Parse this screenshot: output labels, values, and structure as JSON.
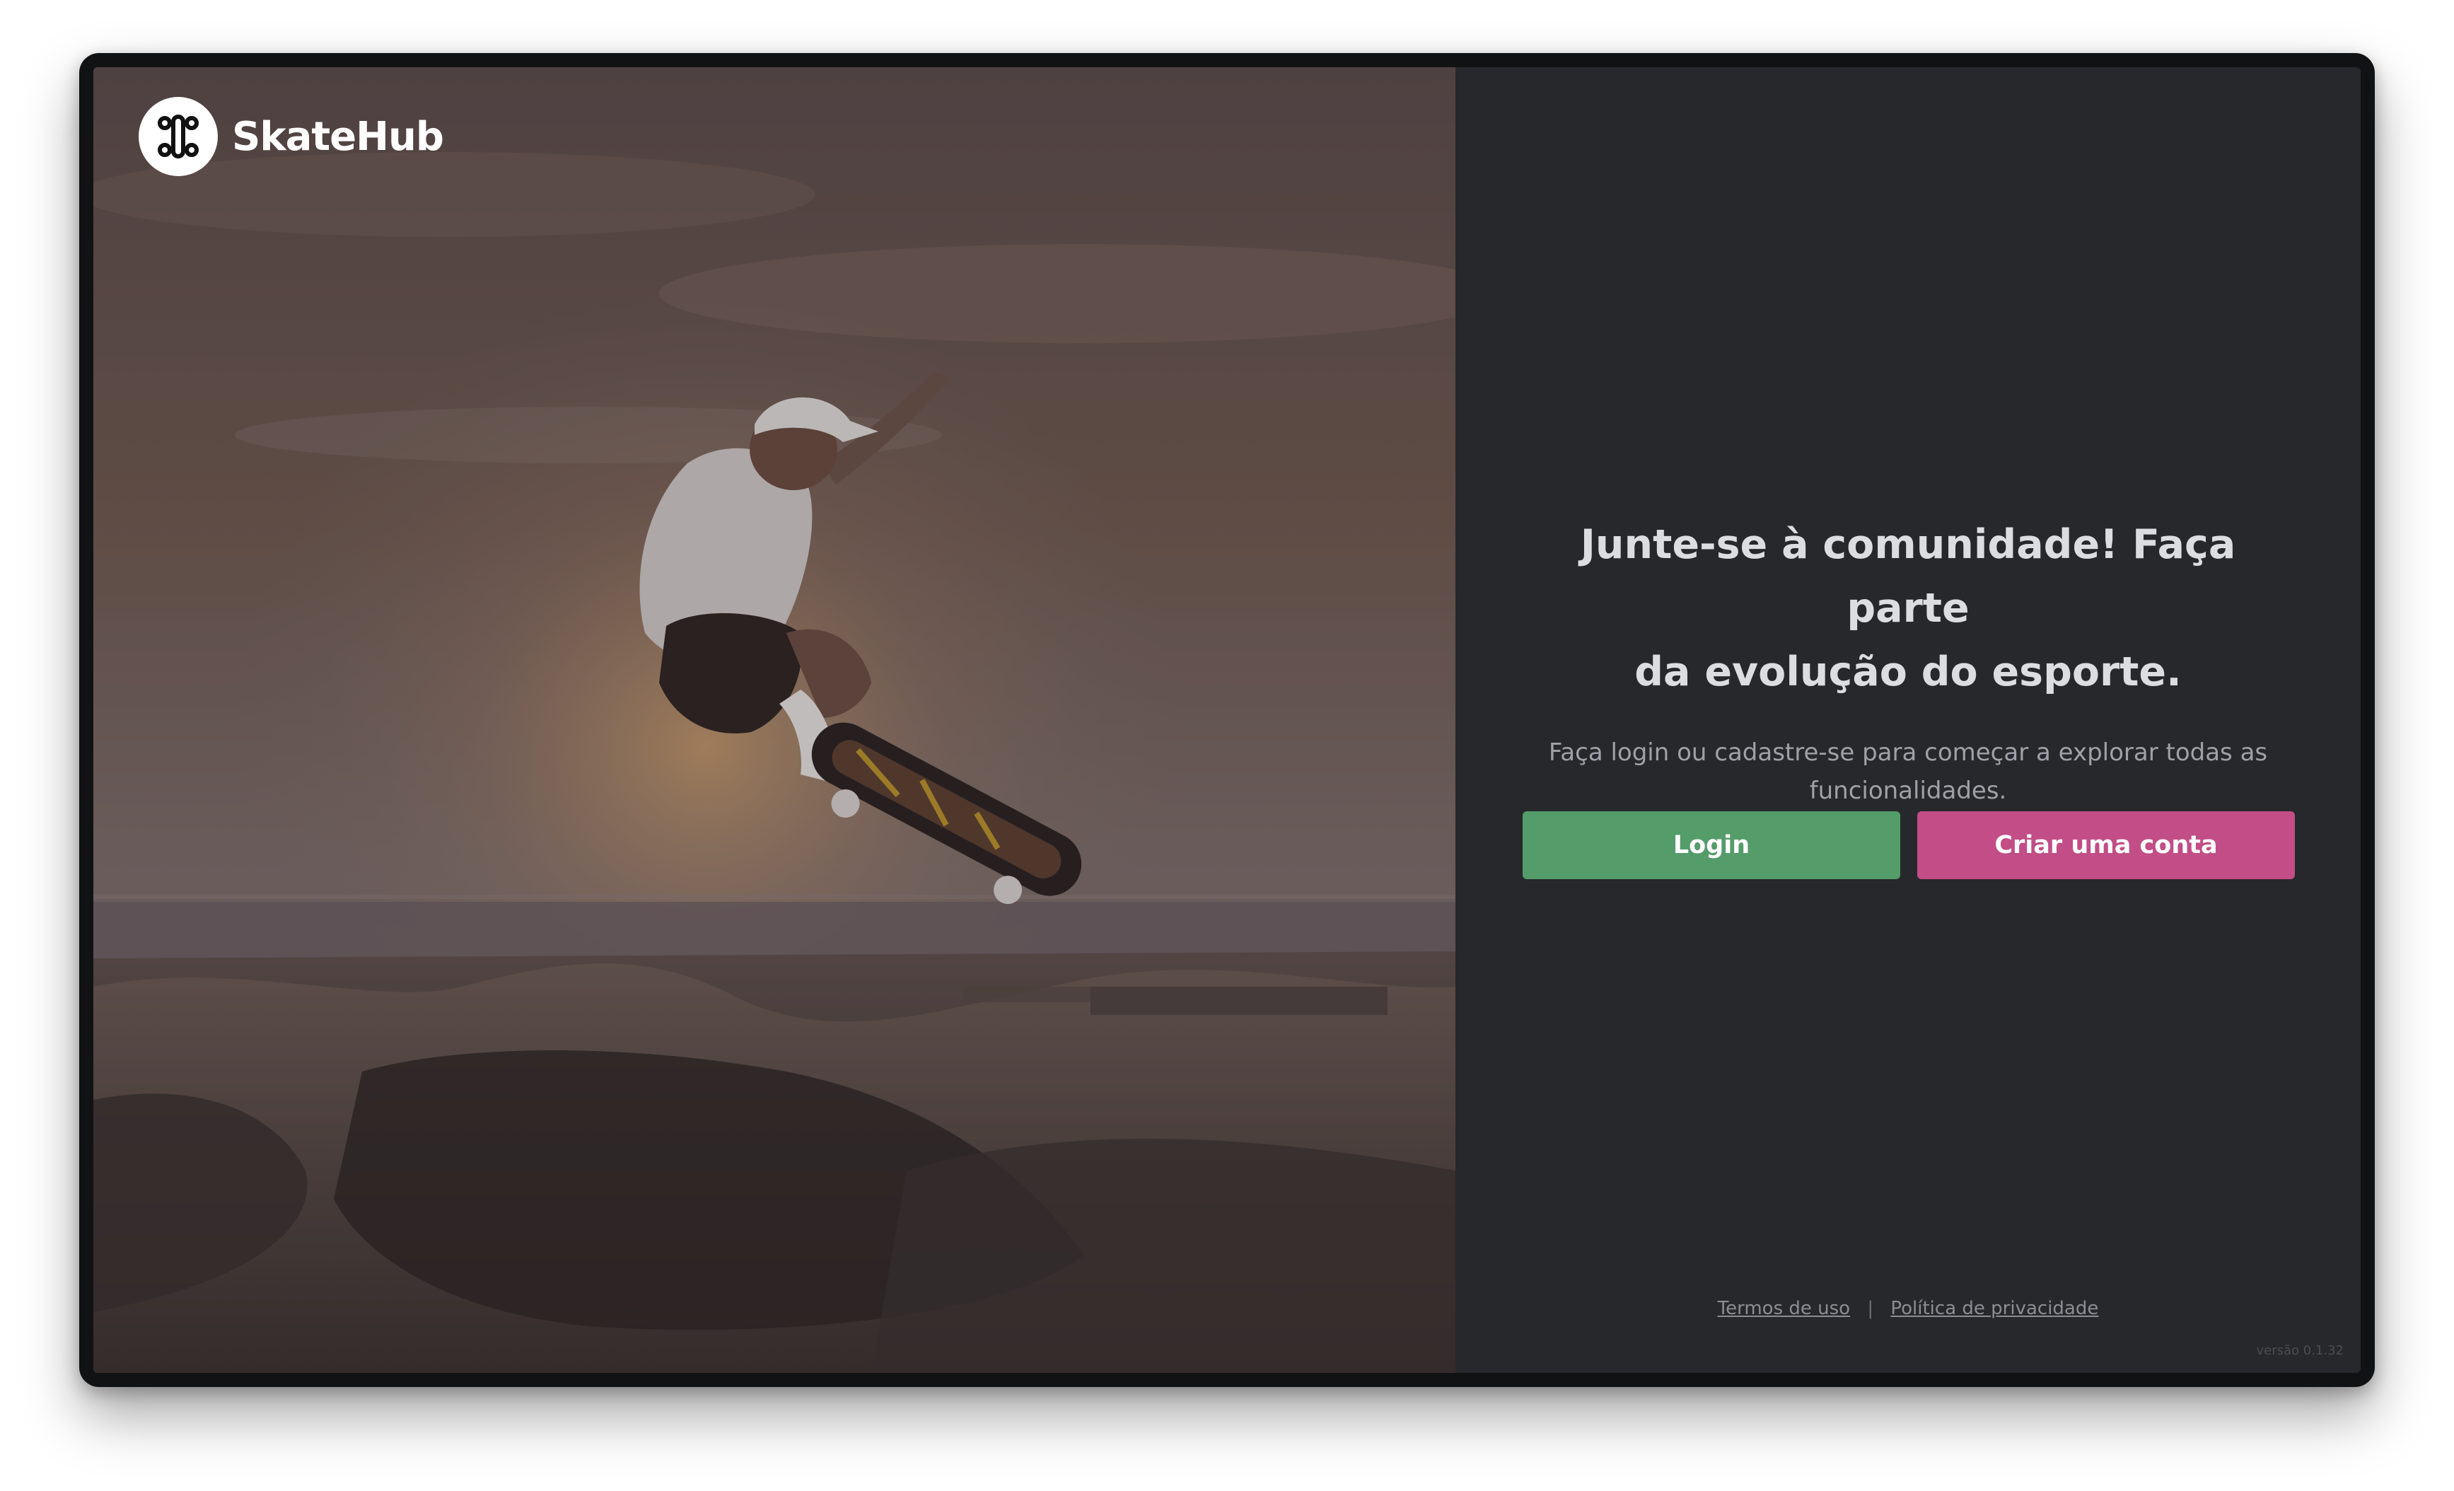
{
  "app": {
    "brand_name": "SkateHub",
    "logo_icon": "skateboard-top-icon"
  },
  "hero": {
    "image_subject": "skateboarder mid-air over a concrete skatepark bowl at sunset",
    "overlay_color": "#26282b"
  },
  "main": {
    "headline_line1": "Junte-se à comunidade! Faça parte",
    "headline_line2": "da evolução do esporte.",
    "subtitle_line1": "Faça login ou cadastre-se para começar a explorar todas as",
    "subtitle_line2": "funcionalidades."
  },
  "actions": {
    "login_label": "Login",
    "signup_label": "Criar uma conta"
  },
  "footer": {
    "terms_label": "Termos de uso",
    "separator": "|",
    "privacy_label": "Política de privacidade",
    "version_text": "versão 0.1.32"
  },
  "colors": {
    "panel_bg": "#26282b",
    "login_button": "#559c6b",
    "signup_button": "#c24d87",
    "headline": "#dcdde0",
    "subtitle": "#9ea2a8"
  }
}
